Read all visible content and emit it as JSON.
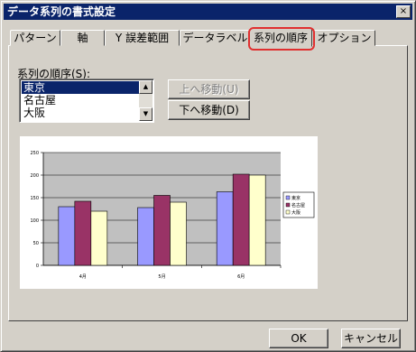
{
  "window": {
    "title": "データ系列の書式設定",
    "close": "×"
  },
  "tabs": [
    {
      "label": "パターン"
    },
    {
      "label": "軸"
    },
    {
      "label": "Y 誤差範囲"
    },
    {
      "label": "データラベル"
    },
    {
      "label": "系列の順序"
    },
    {
      "label": "オプション"
    }
  ],
  "series_order": {
    "label": "系列の順序(S):",
    "items": [
      "東京",
      "名古屋",
      "大阪"
    ],
    "selected": "東京"
  },
  "buttons": {
    "move_up": "上へ移動(U)",
    "move_down": "下へ移動(D)",
    "ok": "OK",
    "cancel": "キャンセル"
  },
  "chart_data": {
    "type": "bar",
    "categories": [
      "4月",
      "5月",
      "6月"
    ],
    "series": [
      {
        "name": "東京",
        "color": "#9999ff",
        "values": [
          130,
          128,
          163
        ]
      },
      {
        "name": "名古屋",
        "color": "#993366",
        "values": [
          142,
          155,
          202
        ]
      },
      {
        "name": "大阪",
        "color": "#ffffcc",
        "values": [
          120,
          140,
          200
        ]
      }
    ],
    "ylim": [
      0,
      250
    ],
    "yticks": [
      "0",
      "50",
      "100",
      "150",
      "200",
      "250"
    ],
    "grid": true,
    "legend": "right"
  }
}
